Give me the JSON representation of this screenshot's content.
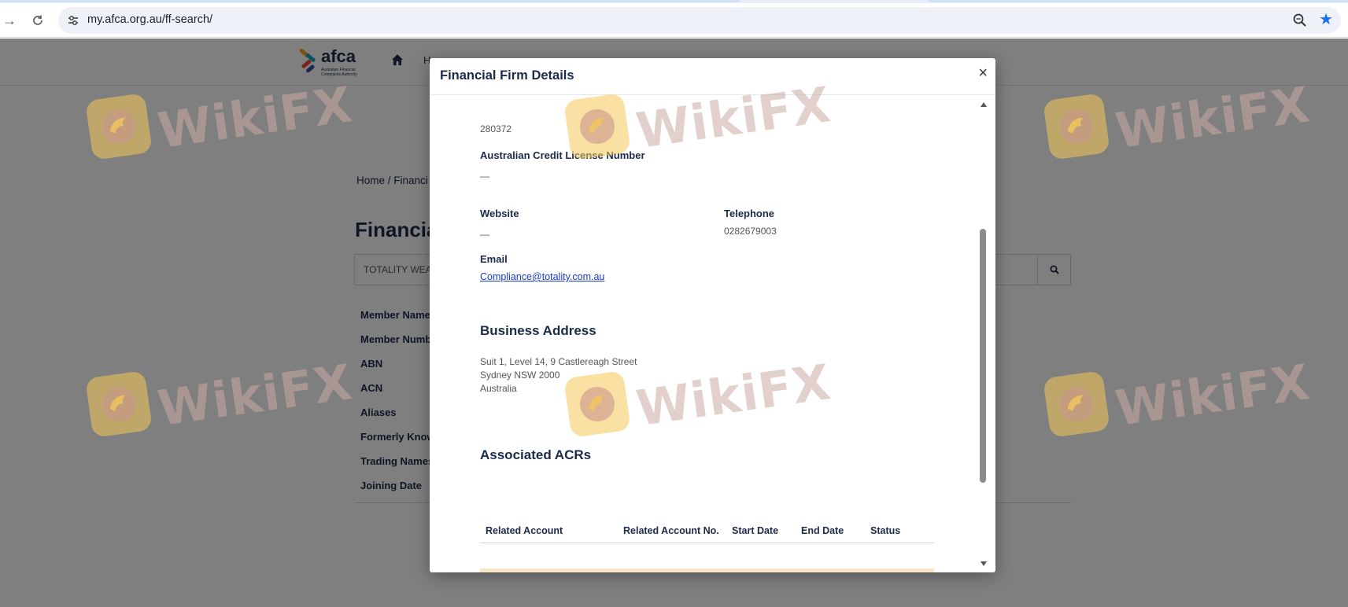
{
  "browser": {
    "url_host": "my.afca.org.au",
    "url_path": "/ff-search/"
  },
  "site": {
    "logo_word": "afca",
    "logo_sub": "Australian Financial Complaints Authority",
    "nav_cut": "H",
    "breadcrumb": "Home  /  Financi",
    "page_title": "Financia",
    "search_value": "TOTALITY WEA",
    "detail_labels": [
      "Member Name",
      "Member Numb",
      "ABN",
      "ACN",
      "Aliases",
      "Formerly Know",
      "Trading Names",
      "Joining Date"
    ]
  },
  "watermark": {
    "text": "WikiFX"
  },
  "modal": {
    "title": "Financial Firm Details",
    "close": "×",
    "top_value": "280372",
    "credit_license_label": "Australian Credit License Number",
    "credit_license_value": "—",
    "website_label": "Website",
    "website_value": "—",
    "telephone_label": "Telephone",
    "telephone_value": "0282679003",
    "email_label": "Email",
    "email_value": "Compliance@totality.com.au",
    "business_address_heading": "Business Address",
    "address_lines": [
      "Suit 1, Level 14, 9 Castlereagh Street",
      "Sydney NSW 2000",
      "Australia"
    ],
    "associated_heading": "Associated ACRs",
    "table_headers": [
      "Related Account",
      "Related Account No.",
      "Start Date",
      "End Date",
      "Status"
    ]
  },
  "colors": {
    "navy": "#1c2a4a",
    "link": "#1a3bd1",
    "stripe": "#fbe6c6",
    "star": "#1a73e8"
  }
}
